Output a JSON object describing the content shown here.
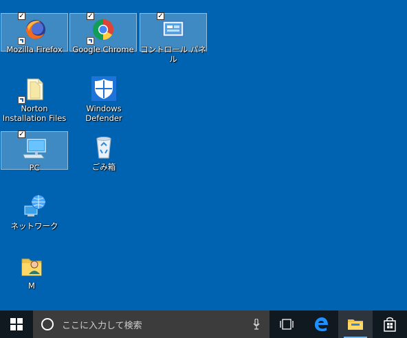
{
  "desktop": {
    "icons": [
      {
        "label": "Mozilla Firefox",
        "selected": true,
        "checked": true,
        "shortcut": true,
        "icon": "firefox-icon"
      },
      {
        "label": "Google Chrome",
        "selected": true,
        "checked": true,
        "shortcut": true,
        "icon": "chrome-icon"
      },
      {
        "label": "コントロール パネル",
        "selected": true,
        "checked": true,
        "shortcut": false,
        "icon": "control-panel-icon"
      },
      {
        "label": "Norton Installation Files",
        "selected": false,
        "checked": false,
        "shortcut": true,
        "icon": "folder-icon"
      },
      {
        "label": "Windows Defender",
        "selected": false,
        "checked": false,
        "shortcut": false,
        "icon": "shield-icon"
      },
      {
        "label": "PC",
        "selected": true,
        "checked": true,
        "shortcut": false,
        "icon": "pc-icon"
      },
      {
        "label": "ごみ箱",
        "selected": false,
        "checked": false,
        "shortcut": false,
        "icon": "recycle-bin-icon"
      },
      {
        "label": "ネットワーク",
        "selected": false,
        "checked": false,
        "shortcut": false,
        "icon": "network-icon"
      },
      {
        "label": "M",
        "selected": false,
        "checked": false,
        "shortcut": false,
        "icon": "user-folder-icon"
      }
    ]
  },
  "taskbar": {
    "search_placeholder": "ここに入力して検索",
    "icons": [
      "windows-start-icon",
      "cortana-icon",
      "microphone-icon",
      "task-view-icon",
      "edge-icon",
      "file-explorer-icon",
      "store-icon"
    ]
  },
  "colors": {
    "desktop_bg": "#0063B1",
    "taskbar_bg": "#101820",
    "search_bg": "#3c3c3c"
  }
}
